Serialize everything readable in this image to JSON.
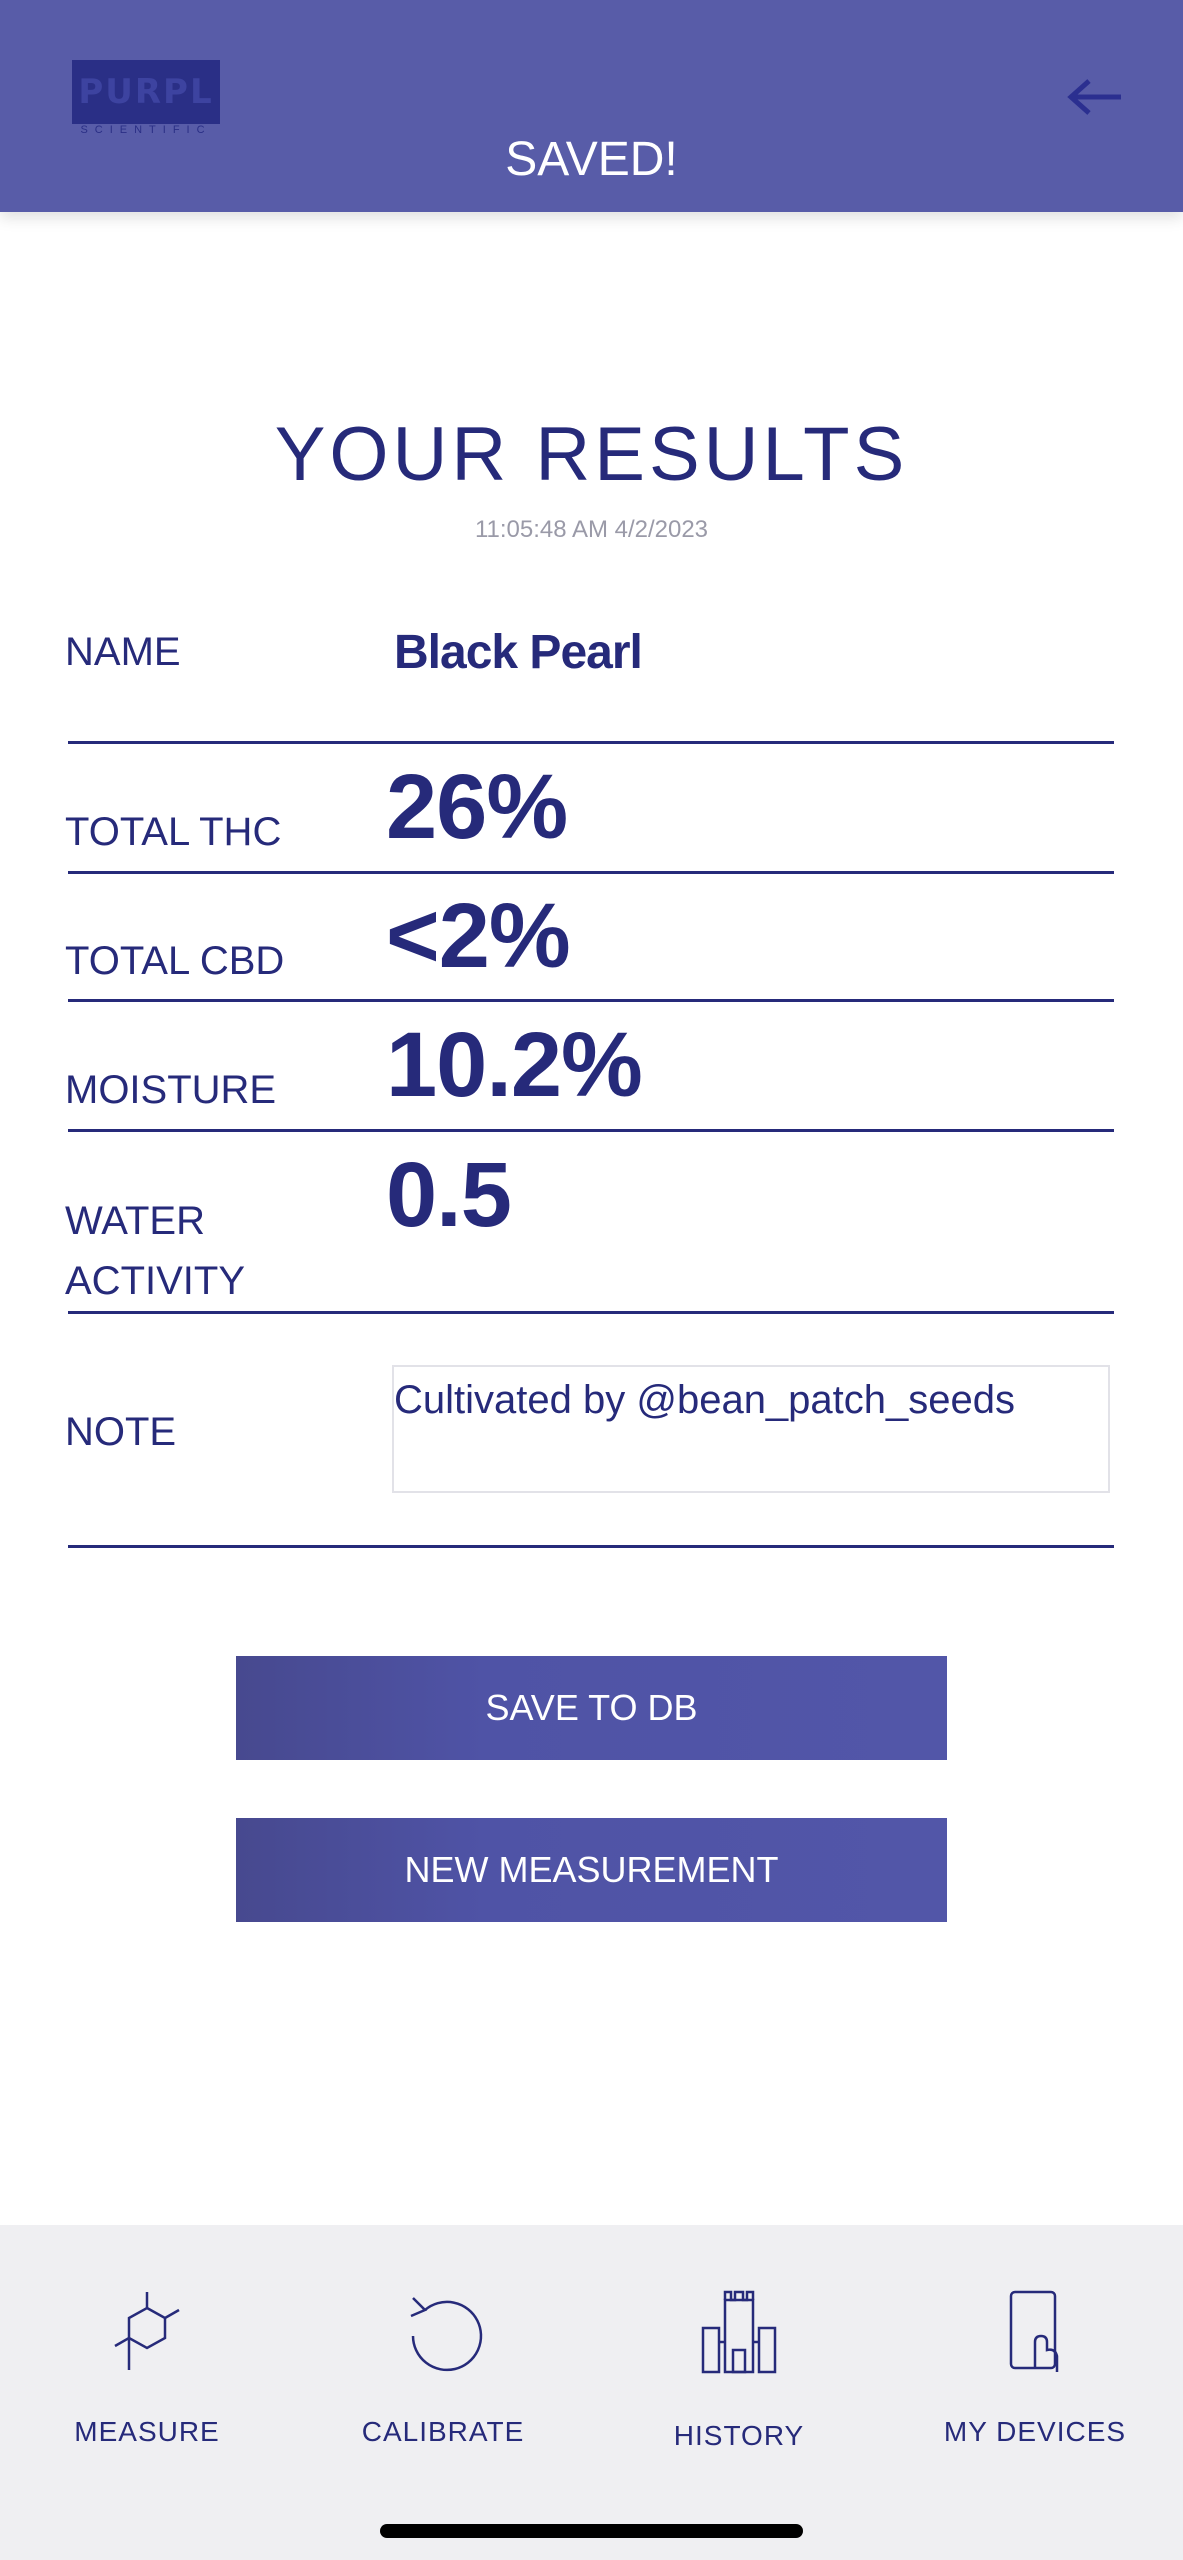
{
  "header": {
    "logo_text": "PURPL",
    "logo_sub": "SCIENTIFIC",
    "title": "SAVED!",
    "back_icon": "left-arrow-icon",
    "colors": {
      "bar": "#585ca8",
      "logo": "#2a2f86"
    }
  },
  "results": {
    "title": "YOUR RESULTS",
    "timestamp": "11:05:48 AM 4/2/2023",
    "rows": {
      "name": {
        "label": "NAME",
        "value": "Black Pearl"
      },
      "thc": {
        "label": "TOTAL THC",
        "value": "26%"
      },
      "cbd": {
        "label": "TOTAL CBD",
        "value": "<2%"
      },
      "moisture": {
        "label": "MOISTURE",
        "value": "10.2%"
      },
      "water_activity": {
        "label_line1": "WATER",
        "label_line2": "ACTIVITY",
        "value": "0.5"
      },
      "note": {
        "label": "NOTE",
        "value": "Cultivated by @bean_patch_seeds"
      }
    }
  },
  "actions": {
    "save_db": "SAVE TO DB",
    "new_measurement": "NEW MEASUREMENT"
  },
  "tabs": [
    {
      "label": "MEASURE",
      "icon": "molecule-icon"
    },
    {
      "label": "CALIBRATE",
      "icon": "refresh-icon"
    },
    {
      "label": "HISTORY",
      "icon": "castle-icon"
    },
    {
      "label": "MY DEVICES",
      "icon": "phone-touch-icon"
    }
  ],
  "theme": {
    "text": "#262a7a",
    "button": "#5256a8",
    "tabbar_bg": "#efeff2"
  }
}
